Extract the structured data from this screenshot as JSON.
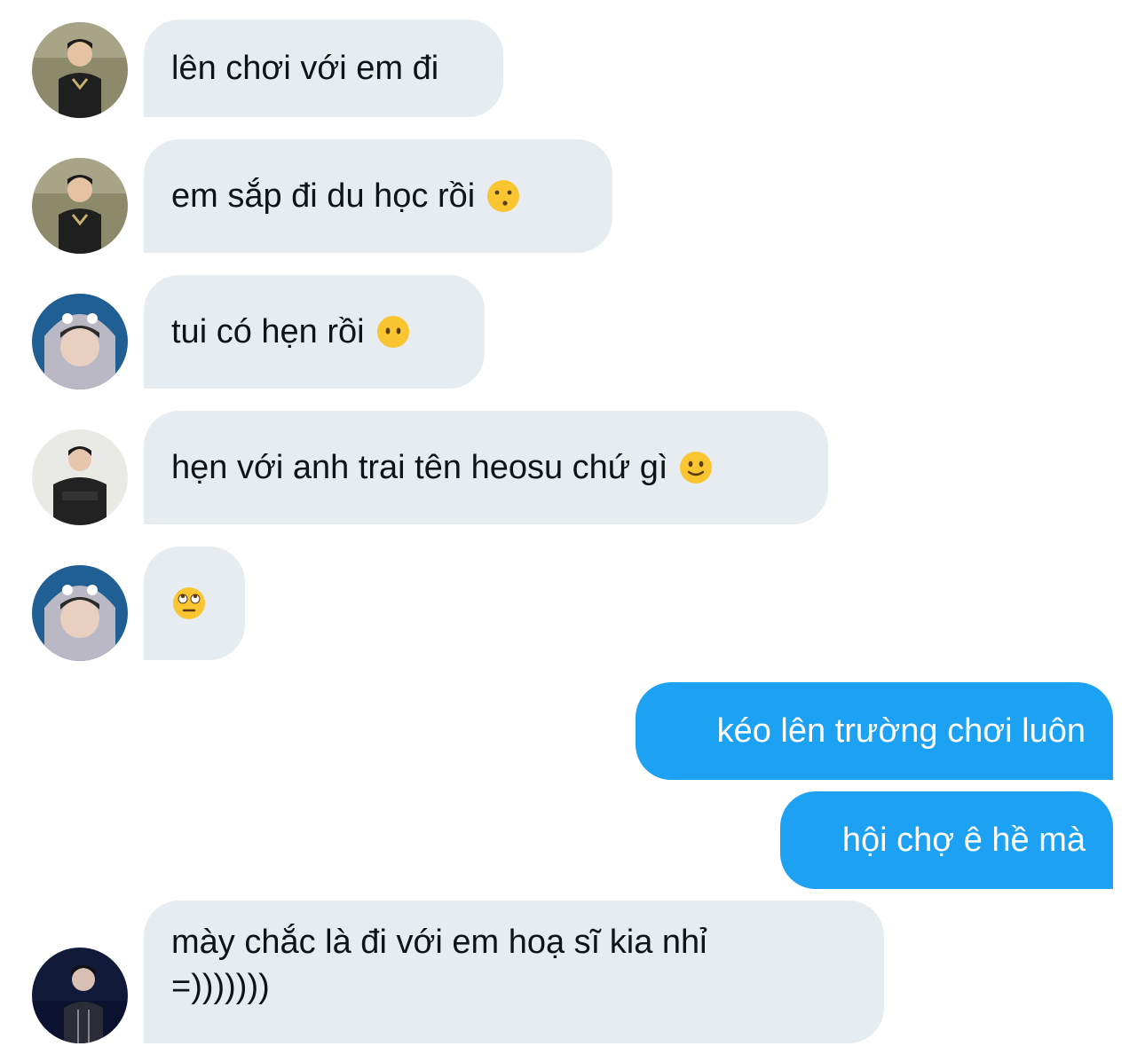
{
  "messages": [
    {
      "side": "in",
      "avatar": "avatar-green-jersey",
      "text": "lên chơi với em đi",
      "emoji": ""
    },
    {
      "side": "in",
      "avatar": "avatar-green-jersey",
      "text": "em sắp đi du học rồi",
      "emoji": "kissing-face-icon"
    },
    {
      "side": "in",
      "avatar": "avatar-hooded",
      "text": "tui có hẹn rồi",
      "emoji": "no-mouth-face-icon"
    },
    {
      "side": "in",
      "avatar": "avatar-studio-portrait",
      "text": "hẹn với anh trai tên heosu chứ gì",
      "emoji": "slight-smile-icon"
    },
    {
      "side": "in",
      "avatar": "avatar-hooded",
      "text": "",
      "emoji": "eye-roll-icon"
    },
    {
      "side": "out",
      "text": "kéo lên trường chơi luôn"
    },
    {
      "side": "out",
      "text": "hội chợ ê hề mà"
    },
    {
      "side": "in",
      "avatar": "avatar-dark-stage",
      "text": "mày chắc là đi với em hoạ sĩ kia nhỉ =)))))))",
      "emoji": ""
    }
  ],
  "colors": {
    "incoming_bubble": "#e6ecf0",
    "outgoing_bubble": "#1da1f2",
    "text_dark": "#0f1419",
    "text_light": "#ffffff"
  }
}
